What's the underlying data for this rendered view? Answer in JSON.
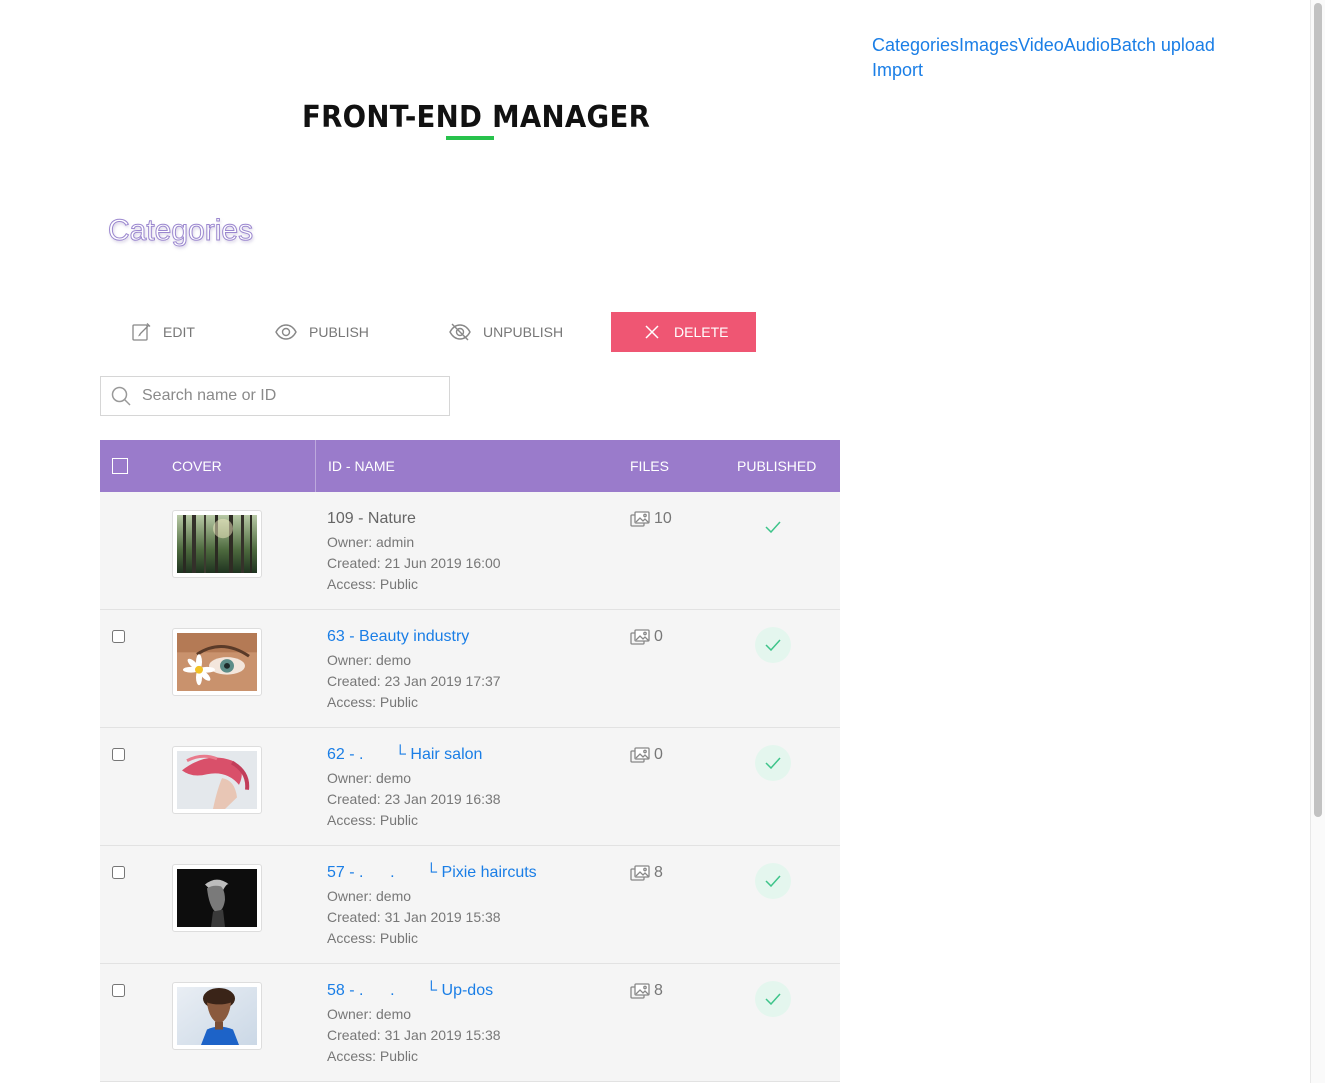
{
  "nav": {
    "categories": "Categories",
    "images": "Images",
    "video": "Video",
    "audio": "Audio",
    "batch_upload": "Batch upload",
    "import": "Import"
  },
  "header": {
    "title": "FRONT-END MANAGER"
  },
  "section": {
    "title": "Categories"
  },
  "toolbar": {
    "edit": "EDIT",
    "publish": "PUBLISH",
    "unpublish": "UNPUBLISH",
    "delete": "DELETE"
  },
  "search": {
    "placeholder": "Search name or ID"
  },
  "table": {
    "headers": {
      "cover": "COVER",
      "id_name": "ID - NAME",
      "files": "FILES",
      "published": "PUBLISHED"
    },
    "rows": [
      {
        "name": "109 - Nature",
        "prefix": "",
        "title": "",
        "owner": "Owner: admin",
        "created": "Created: 21 Jun 2019 16:00",
        "access": "Access: Public",
        "files": "10",
        "published": true
      },
      {
        "name": "63 - Beauty industry",
        "prefix": "",
        "title": "",
        "owner": "Owner: demo",
        "created": "Created: 23 Jan 2019 17:37",
        "access": "Access: Public",
        "files": "0",
        "published": true
      },
      {
        "name": "",
        "prefix": "62 - .",
        "title": "Hair salon",
        "owner": "Owner: demo",
        "created": "Created: 23 Jan 2019 16:38",
        "access": "Access: Public",
        "files": "0",
        "published": true
      },
      {
        "name": "",
        "prefix": "57 - .",
        "prefix2": ".",
        "title": "Pixie haircuts",
        "owner": "Owner: demo",
        "created": "Created: 31 Jan 2019 15:38",
        "access": "Access: Public",
        "files": "8",
        "published": true
      },
      {
        "name": "",
        "prefix": "58 - .",
        "prefix2": ".",
        "title": "Up-dos",
        "owner": "Owner: demo",
        "created": "Created: 31 Jan 2019 15:38",
        "access": "Access: Public",
        "files": "8",
        "published": true
      }
    ]
  },
  "colors": {
    "accent": "#9a7bcb",
    "link": "#1a7ee6",
    "delete": "#ef5673",
    "published_check": "#3ec48a"
  }
}
